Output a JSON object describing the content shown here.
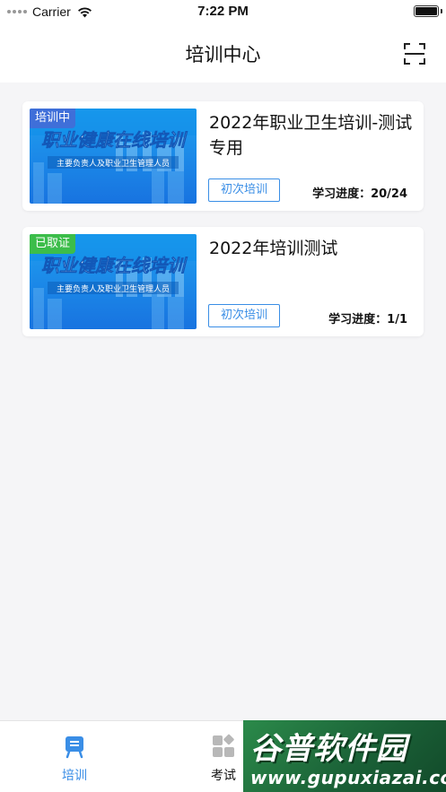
{
  "status_bar": {
    "carrier": "Carrier",
    "time": "7:22 PM"
  },
  "nav": {
    "title": "培训中心"
  },
  "cards": [
    {
      "badge": "培训中",
      "badge_color": "#3f6fd9",
      "banner_title": "职业健康在线培训",
      "banner_sub": "主要负责人及职业卫生管理人员",
      "title": "2022年职业卫生培训-测试专用",
      "tag": "初次培训",
      "progress": "学习进度：20/24"
    },
    {
      "badge": "已取证",
      "badge_color": "#3cbd4a",
      "banner_title": "职业健康在线培训",
      "banner_sub": "主要负责人及职业卫生管理人员",
      "title": "2022年培训测试",
      "tag": "初次培训",
      "progress": "学习进度：1/1"
    }
  ],
  "tabs": [
    {
      "label": "培训",
      "icon": "training-icon"
    },
    {
      "label": "考试",
      "icon": "exam-grid-icon"
    }
  ],
  "watermark": {
    "title": "谷普软件园",
    "url": "www.gupuxiazai.com"
  },
  "colors": {
    "accent": "#3a8ee6",
    "active_badge": "#3f6fd9",
    "certified_badge": "#3cbd4a"
  }
}
